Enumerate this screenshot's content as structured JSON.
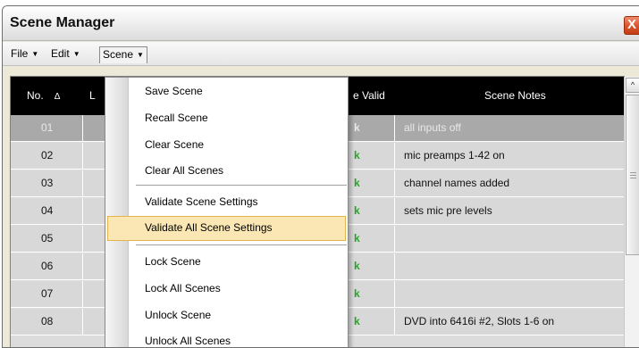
{
  "window": {
    "title": "Scene Manager",
    "close_glyph": "X"
  },
  "menubar": {
    "items": [
      {
        "label": "File",
        "arrow": "▼"
      },
      {
        "label": "Edit",
        "arrow": "▼"
      },
      {
        "label": "Scene",
        "arrow": "▼"
      }
    ]
  },
  "grid": {
    "columns": {
      "no": "No.",
      "sort_glyph": "Δ",
      "partial_l": "L",
      "valid_partial": "e Valid",
      "notes": "Scene Notes"
    },
    "rows": [
      {
        "no": "01",
        "valid": "k",
        "notes": "all inputs off",
        "selected": true
      },
      {
        "no": "02",
        "valid": "k",
        "notes": "mic preamps 1-42 on"
      },
      {
        "no": "03",
        "valid": "k",
        "notes": "channel names added"
      },
      {
        "no": "04",
        "valid": "k",
        "notes": "sets mic pre levels"
      },
      {
        "no": "05",
        "valid": "k",
        "notes": ""
      },
      {
        "no": "06",
        "valid": "k",
        "notes": ""
      },
      {
        "no": "07",
        "valid": "k",
        "notes": ""
      },
      {
        "no": "08",
        "valid": "k",
        "notes": "DVD into 6416i #2, Slots 1-6 on"
      }
    ]
  },
  "scene_menu": {
    "items": [
      {
        "label": "Save Scene"
      },
      {
        "label": "Recall Scene"
      },
      {
        "label": "Clear Scene"
      },
      {
        "label": "Clear All Scenes"
      },
      {
        "label": "Validate Scene Settings"
      },
      {
        "label": "Validate All Scene Settings",
        "highlighted": true
      },
      {
        "label": "Lock Scene"
      },
      {
        "label": "Lock All Scenes"
      },
      {
        "label": "Unlock Scene"
      },
      {
        "label": "Unlock All Scenes"
      }
    ]
  },
  "scrollbar": {
    "up_glyph": "^"
  },
  "colors": {
    "valid_text": "#2aa12a",
    "header_bg": "#000000",
    "menu_highlight": "#fbe7b4",
    "close_button": "#d9542c"
  }
}
